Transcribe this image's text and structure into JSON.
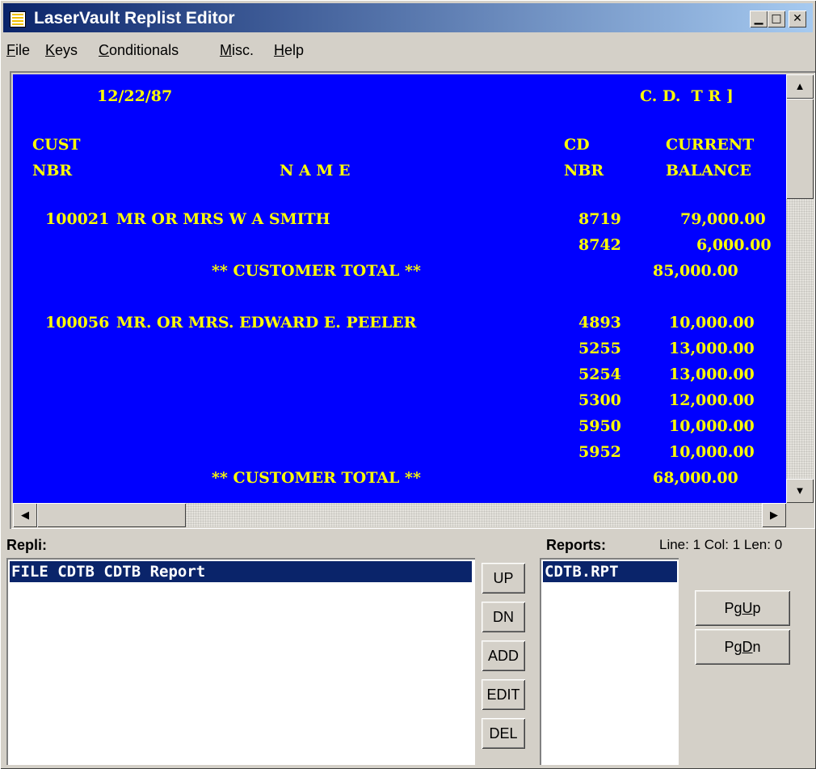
{
  "window": {
    "title": "LaserVault Replist Editor",
    "title_buttons": [
      {
        "name": "minimize-button",
        "glyph": "▁"
      },
      {
        "name": "maximize-button",
        "glyph": "□"
      },
      {
        "name": "close-button",
        "glyph": "✕"
      }
    ]
  },
  "menu": [
    {
      "label": "File",
      "accel": "F",
      "rest": "ile"
    },
    {
      "label": "Keys",
      "accel": "K",
      "rest": "eys"
    },
    {
      "label": "Conditionals",
      "accel": "C",
      "rest": "onditionals"
    },
    {
      "label": "Misc.",
      "accel": "M",
      "rest": "isc."
    },
    {
      "label": "Help",
      "accel": "H",
      "rest": "elp"
    }
  ],
  "report": {
    "date": "12/22/87",
    "title_fragment": "C. D.  T R ]",
    "headers": {
      "cust": "CUST",
      "cust_nbr": "NBR",
      "name": "N A M E",
      "cd": "CD",
      "cd_nbr": "NBR",
      "current": "CURRENT",
      "balance": "BALANCE"
    },
    "rows": [
      {
        "cust": "100021",
        "name": "MR OR MRS W A SMITH",
        "cd": "8719",
        "balance": "79,000.00"
      },
      {
        "cust": "",
        "name": "",
        "cd": "8742",
        "balance": "6,000.00"
      },
      {
        "total_label": "** CUSTOMER TOTAL **",
        "total": "85,000.00"
      },
      {
        "cust": "100056",
        "name": "MR. OR MRS. EDWARD E. PEELER",
        "cd": "4893",
        "balance": "10,000.00"
      },
      {
        "cust": "",
        "name": "",
        "cd": "5255",
        "balance": "13,000.00"
      },
      {
        "cust": "",
        "name": "",
        "cd": "5254",
        "balance": "13,000.00"
      },
      {
        "cust": "",
        "name": "",
        "cd": "5300",
        "balance": "12,000.00"
      },
      {
        "cust": "",
        "name": "",
        "cd": "5950",
        "balance": "10,000.00"
      },
      {
        "cust": "",
        "name": "",
        "cd": "5952",
        "balance": "10,000.00"
      },
      {
        "total_label": "** CUSTOMER TOTAL **",
        "total": "68,000.00"
      }
    ]
  },
  "replist": {
    "label": "Repli:",
    "items": [
      "FILE CDTB CDTB Report"
    ],
    "selected": 0
  },
  "list_buttons": [
    "UP",
    "DN",
    "ADD",
    "EDIT",
    "DEL"
  ],
  "reports": {
    "label": "Reports:",
    "items": [
      "CDTB.RPT"
    ],
    "selected": 0
  },
  "status": "Line: 1 Col: 1 Len: 0",
  "page_buttons": [
    {
      "label": "PgUp",
      "pre": "Pg",
      "accel": "U",
      "rest": "p"
    },
    {
      "label": "PgDn",
      "pre": "Pg",
      "accel": "D",
      "rest": "n"
    }
  ],
  "colors": {
    "screen_bg": "#0000ff",
    "screen_text": "#ffff00",
    "selection": "#0a246a",
    "title_start": "#0a246a",
    "title_end": "#a6caf0"
  }
}
